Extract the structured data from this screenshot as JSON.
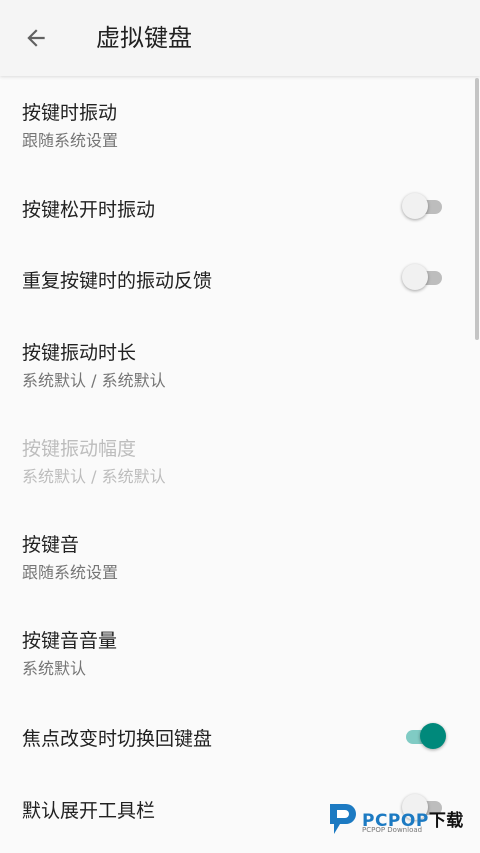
{
  "toolbar": {
    "back_icon": "arrow-back-icon",
    "title": "虚拟键盘"
  },
  "accent_color": "#00897b",
  "items": [
    {
      "title": "按键时振动",
      "summary": "跟随系统设置"
    },
    {
      "title": "按键松开时振动",
      "switch": "off"
    },
    {
      "title": "重复按键时的振动反馈",
      "switch": "off"
    },
    {
      "title": "按键振动时长",
      "summary": "系统默认 / 系统默认"
    },
    {
      "title": "按键振动幅度",
      "summary": "系统默认 / 系统默认",
      "disabled": true
    },
    {
      "title": "按键音",
      "summary": "跟随系统设置"
    },
    {
      "title": "按键音音量",
      "summary": "系统默认"
    },
    {
      "title": "焦点改变时切换回键盘",
      "switch": "on"
    },
    {
      "title": "默认展开工具栏",
      "switch": "off"
    }
  ],
  "watermark": {
    "brand": "PCPOP",
    "suffix": "下载",
    "sub": "PCPOP Download"
  }
}
